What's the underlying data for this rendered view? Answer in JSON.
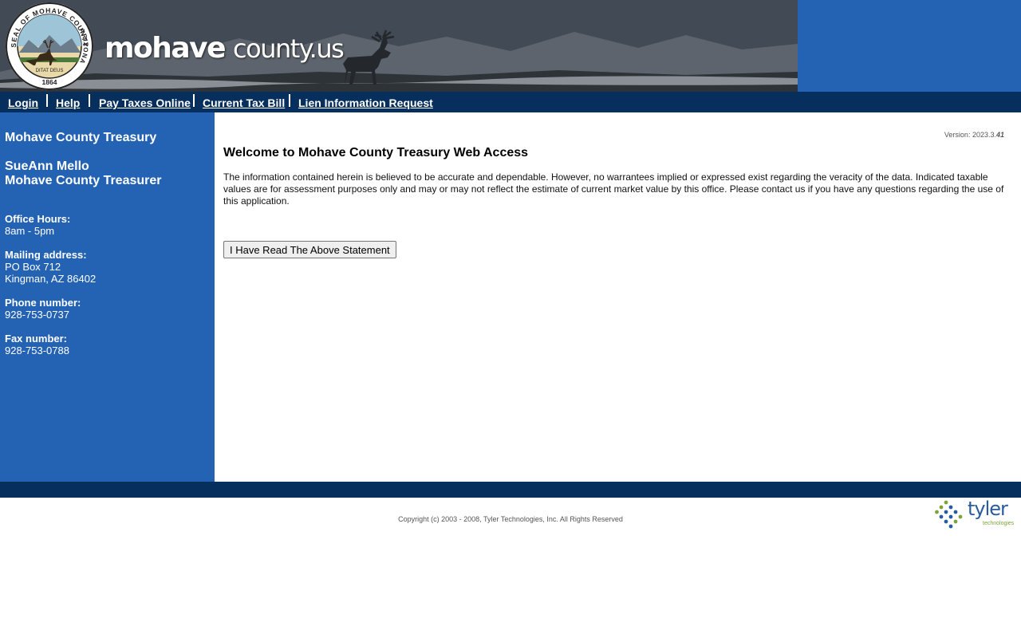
{
  "header": {
    "site_name_bold": "mohave",
    "site_name_regular": "county.us",
    "seal": {
      "top_text": "SEAL OF MOHAVE COUNTY",
      "side_text": "ARIZONA",
      "motto": "DITAT DEUS",
      "year": "1864"
    }
  },
  "nav": {
    "items": [
      {
        "label": "Login"
      },
      {
        "label": "Help"
      },
      {
        "label": "Pay Taxes Online"
      },
      {
        "label": "Current Tax Bill"
      },
      {
        "label": "Lien Information Request"
      }
    ]
  },
  "sidebar": {
    "title": "Mohave County Treasury",
    "treasurer_name": "SueAnn Mello",
    "treasurer_title": "Mohave County Treasurer",
    "office_hours_label": "Office Hours:",
    "office_hours": "8am - 5pm",
    "mailing_label": "Mailing address:",
    "mailing_line1": "PO Box 712",
    "mailing_line2": "Kingman, AZ 86402",
    "phone_label": "Phone number:",
    "phone": "928-753-0737",
    "fax_label": "Fax number:",
    "fax": "928-753-0788"
  },
  "main": {
    "version_label": "Version: 2023.3.",
    "version_build": "41",
    "welcome_title": "Welcome to Mohave County Treasury Web Access",
    "disclaimer": "The information contained herein is believed to be accurate and dependable. However, no warrantees implied or expressed exist regarding the veracity of the data. Indicated taxable values are for assessment purposes only and may or may not reflect the estimate of current market value by this office. Please contact us if you have any questions regarding the use of this application.",
    "ack_button_label": "I Have Read The Above Statement"
  },
  "footer": {
    "copyright": "Copyright (c) 2003 - 2008, Tyler Technologies, Inc. All Rights Reserved",
    "logo_text": "tyler",
    "logo_subtext": "technologies"
  },
  "colors": {
    "banner_blue": "#2462b4",
    "nav_navy": "#062f5e",
    "banner_gray": "#414a55",
    "tyler_blue": "#2a5aa0",
    "tyler_green": "#7ea33a"
  }
}
